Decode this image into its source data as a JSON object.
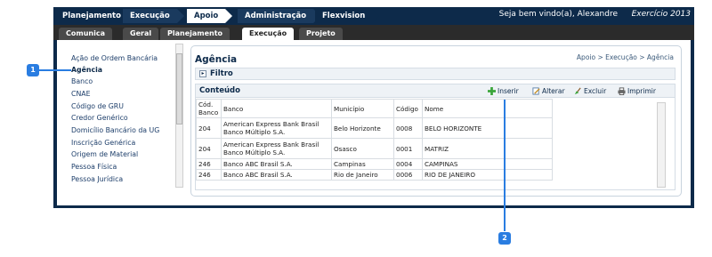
{
  "top_tabs": [
    {
      "label": "Planejamento"
    },
    {
      "label": "Execução"
    },
    {
      "label": "Apoio"
    },
    {
      "label": "Administração"
    },
    {
      "label": "Flexvision"
    }
  ],
  "welcome": "Seja bem vindo(a), Alexandre",
  "year": "Exercício 2013",
  "sub_tabs": [
    {
      "label": "Comunica"
    },
    {
      "label": "Geral"
    },
    {
      "label": "Planejamento"
    },
    {
      "label": "Execução"
    },
    {
      "label": "Projeto"
    }
  ],
  "sidebar": {
    "items": [
      {
        "label": "Ação de Ordem Bancária"
      },
      {
        "label": "Agência"
      },
      {
        "label": "Banco"
      },
      {
        "label": "CNAE"
      },
      {
        "label": "Código de GRU"
      },
      {
        "label": "Credor Genérico"
      },
      {
        "label": "Domicílio Bancário da UG"
      },
      {
        "label": "Inscrição Genérica"
      },
      {
        "label": "Origem de Material"
      },
      {
        "label": "Pessoa Física"
      },
      {
        "label": "Pessoa Jurídica"
      }
    ]
  },
  "panel": {
    "title": "Agência",
    "breadcrumb": "Apoio > Execução > Agência",
    "filter_label": "Filtro",
    "content_label": "Conteúdo"
  },
  "toolbar": {
    "insert": "Inserir",
    "edit": "Alterar",
    "delete": "Excluir",
    "print": "Imprimir"
  },
  "table": {
    "columns": [
      "Cód. Banco",
      "Banco",
      "Município",
      "Código",
      "Nome"
    ],
    "rows": [
      [
        "204",
        "American Express Bank Brasil Banco Múltiplo S.A.",
        "Belo Horizonte",
        "0008",
        "BELO HORIZONTE"
      ],
      [
        "204",
        "American Express Bank Brasil Banco Múltiplo S.A.",
        "Osasco",
        "0001",
        "MATRIZ"
      ],
      [
        "246",
        "Banco ABC Brasil S.A.",
        "Campinas",
        "0004",
        "CAMPINAS"
      ],
      [
        "246",
        "Banco ABC Brasil S.A.",
        "Rio de Janeiro",
        "0006",
        "RIO DE JANEIRO"
      ]
    ]
  },
  "callouts": {
    "one": "1",
    "two": "2"
  },
  "colors": {
    "nav_dark": "#0d2a4a",
    "callout_blue": "#2a7de1"
  }
}
